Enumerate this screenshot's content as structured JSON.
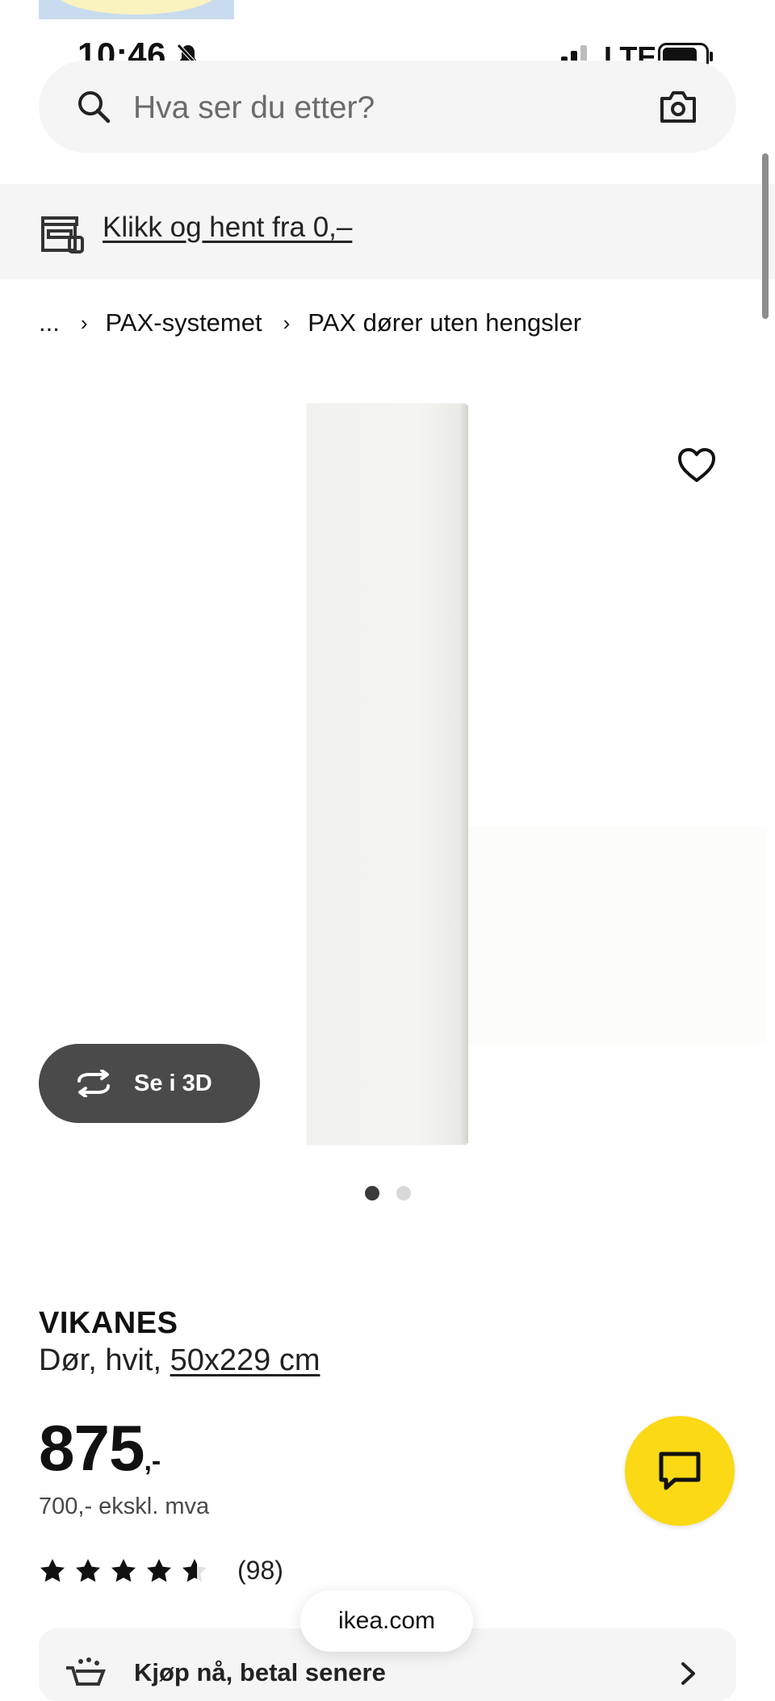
{
  "status_bar": {
    "time": "10:46",
    "network": "LTE"
  },
  "search": {
    "placeholder": "Hva ser du etter?"
  },
  "banner": {
    "link_text": "Klikk og hent fra 0,–"
  },
  "breadcrumb": {
    "items": [
      "...",
      "PAX-systemet",
      "PAX dører uten hengsler"
    ]
  },
  "gallery": {
    "button_3d_label": "Se i 3D",
    "current_image": 1,
    "total_images": 2
  },
  "product": {
    "name": "VIKANES",
    "description_prefix": "Dør, hvit,",
    "size_link": "50x229 cm",
    "price_integer": "875",
    "price_suffix": ",-",
    "price_excl_vat": "700,- ekskl. mva",
    "rating_value": 4.6,
    "rating_max": 5,
    "rating_count": "(98)"
  },
  "browser": {
    "url": "ikea.com"
  },
  "payment": {
    "label": "Kjøp nå, betal senere"
  },
  "colors": {
    "accent_yellow": "#fbd914",
    "button_dark": "#4a4a4a"
  }
}
